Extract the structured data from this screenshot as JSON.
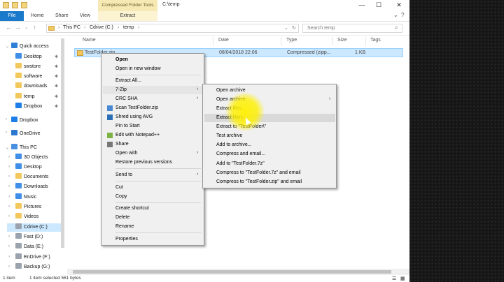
{
  "window": {
    "title": "C:\\temp",
    "contextual_tab_title": "Compressed Folder Tools",
    "min_glyph": "—",
    "max_glyph": "☐",
    "close_glyph": "✕"
  },
  "ribbon": {
    "tabs": [
      "File",
      "Home",
      "Share",
      "View"
    ],
    "contextual_tab": "Extract",
    "help_glyph": "?",
    "expand_glyph": "⌄"
  },
  "address": {
    "path": [
      "This PC",
      "Cdrive (C:)",
      "temp"
    ],
    "search_placeholder": "Search temp"
  },
  "nav_pane": {
    "quick_access_label": "Quick access",
    "pinned": [
      "Desktop",
      "swstore",
      "software",
      "downloads",
      "temp",
      "Dropbox"
    ],
    "dropbox_label": "Dropbox",
    "onedrive_label": "OneDrive",
    "thispc_label": "This PC",
    "thispc_children": [
      "3D Objects",
      "Desktop",
      "Documents",
      "Downloads",
      "Music",
      "Pictures",
      "Videos",
      "Cdrive (C:)",
      "Fast (D:)",
      "Data (E:)",
      "EnDrive (F:)",
      "Backup (G:)"
    ]
  },
  "columns": {
    "name": "Name",
    "date": "Date",
    "type": "Type",
    "size": "Size",
    "tags": "Tags"
  },
  "file": {
    "name": "TestFolder.zip",
    "date": "08/04/2018 22:06",
    "type": "Compressed (zipp...",
    "size": "1 KB"
  },
  "context_menu": {
    "items": [
      "Open",
      "Open in new window",
      "Extract All...",
      "7-Zip",
      "CRC SHA",
      "Scan TestFolder.zip",
      "Shred using AVG",
      "Pin to Start",
      "Edit with Notepad++",
      "Share",
      "Open with",
      "Restore previous versions",
      "Send to",
      "Cut",
      "Copy",
      "Create shortcut",
      "Delete",
      "Rename",
      "Properties"
    ]
  },
  "sevenzip_menu": {
    "items": [
      "Open archive",
      "Open archive",
      "Extract files...",
      "Extract Here",
      "Extract to \"TestFolder\\\"",
      "Test archive",
      "Add to archive...",
      "Compress and email...",
      "Add to \"TestFolder.7z\"",
      "Compress to \"TestFolder.7z\" and email",
      "Add to \"TestFolder.zip\"",
      "Compress to \"TestFolder.zip\" and email"
    ]
  },
  "status": {
    "items_count": "1 item",
    "selection": "1 item selected  561 bytes"
  },
  "colors": {
    "file_tab": "#1979ca",
    "selection": "#cce8ff",
    "contextual_tab": "#f7e9b4",
    "highlight_circle": "#fff000"
  },
  "icons": [
    "folder-icon",
    "zip-icon",
    "drive-icon",
    "pin-icon",
    "chevron-icon",
    "search-icon"
  ]
}
